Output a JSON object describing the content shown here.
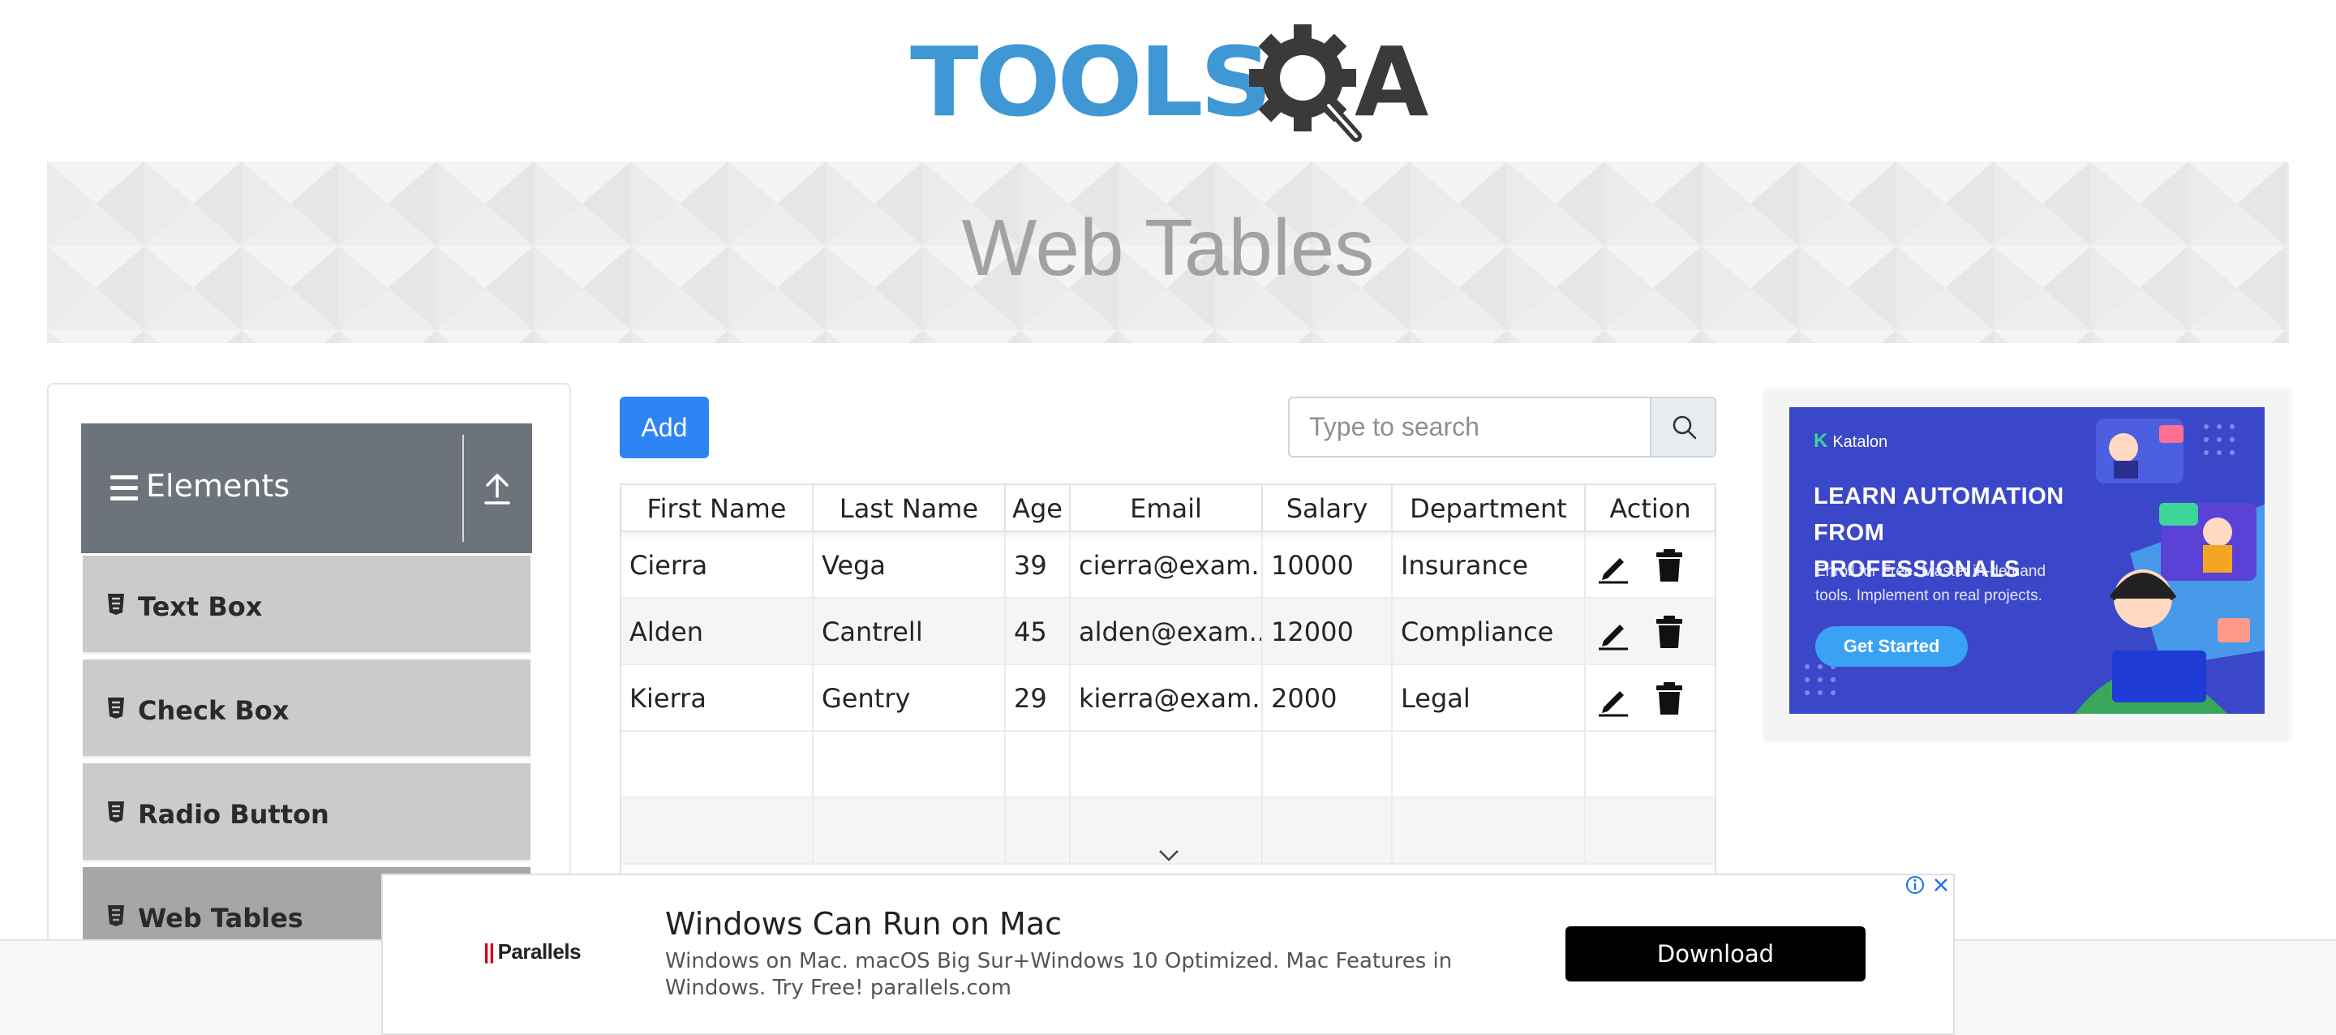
{
  "logo": {
    "text": "TOOLS",
    "letter_a": "A",
    "brand_blue": "#3f97d4",
    "dark": "#3a3a3a"
  },
  "banner": {
    "title": "Web Tables"
  },
  "sidebar": {
    "group_label": "Elements",
    "items": [
      {
        "label": "Text Box",
        "active": false
      },
      {
        "label": "Check Box",
        "active": false
      },
      {
        "label": "Radio Button",
        "active": false
      },
      {
        "label": "Web Tables",
        "active": true
      }
    ]
  },
  "toolbar": {
    "add_label": "Add",
    "search_placeholder": "Type to search",
    "accent": "#2f84f4"
  },
  "table": {
    "headers": [
      "First Name",
      "Last Name",
      "Age",
      "Email",
      "Salary",
      "Department",
      "Action"
    ],
    "rows": [
      {
        "first": "Cierra",
        "last": "Vega",
        "age": "39",
        "email": "cierra@exam...",
        "salary": "10000",
        "department": "Insurance"
      },
      {
        "first": "Alden",
        "last": "Cantrell",
        "age": "45",
        "email": "alden@exam...",
        "salary": "12000",
        "department": "Compliance"
      },
      {
        "first": "Kierra",
        "last": "Gentry",
        "age": "29",
        "email": "kierra@exam...",
        "salary": "2000",
        "department": "Legal"
      }
    ],
    "action_icons": [
      "pencil-icon",
      "trash-icon"
    ]
  },
  "ad_right": {
    "brand": "Katalon",
    "headline": "LEARN AUTOMATION FROM PROFESSIONALS",
    "subtext": "Enroll for Free. Master in-demand tools. Implement on real projects.",
    "cta": "Get Started",
    "bg": "#3b47c9"
  },
  "ad_bottom": {
    "brand": "Parallels",
    "title": "Windows Can Run on Mac",
    "description": "Windows on Mac. macOS Big Sur+Windows 10 Optimized. Mac Features in Windows. Try Free! parallels.com",
    "button": "Download"
  }
}
